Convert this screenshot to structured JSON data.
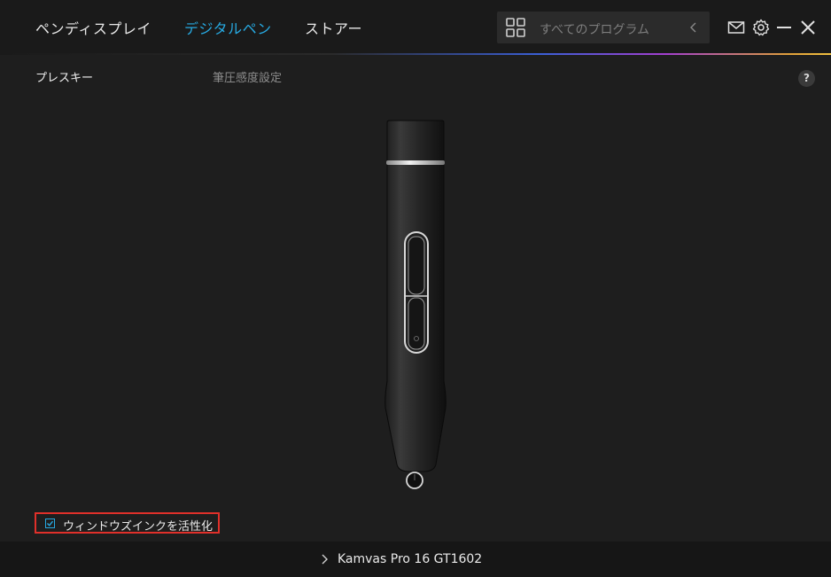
{
  "nav": {
    "tabs": [
      {
        "label": "ペンディスプレイ",
        "active": false
      },
      {
        "label": "デジタルペン",
        "active": true
      },
      {
        "label": "ストアー",
        "active": false
      }
    ]
  },
  "search": {
    "placeholder": "すべてのプログラム",
    "icon": "grid-icon",
    "back_icon": "chevron-left-icon"
  },
  "window_controls": [
    "mail-icon",
    "gear-icon",
    "minimize-icon",
    "close-icon"
  ],
  "subtabs": [
    {
      "label": "プレスキー",
      "active": true
    },
    {
      "label": "筆圧感度設定",
      "active": false
    }
  ],
  "help": {
    "label": "?"
  },
  "windows_ink": {
    "label": "ウィンドウズインクを活性化",
    "checked": true
  },
  "footer": {
    "device": "Kamvas Pro 16 GT1602"
  },
  "colors": {
    "accent": "#27a9e1",
    "highlight_border": "#e0302a",
    "background": "#1e1e1e"
  }
}
